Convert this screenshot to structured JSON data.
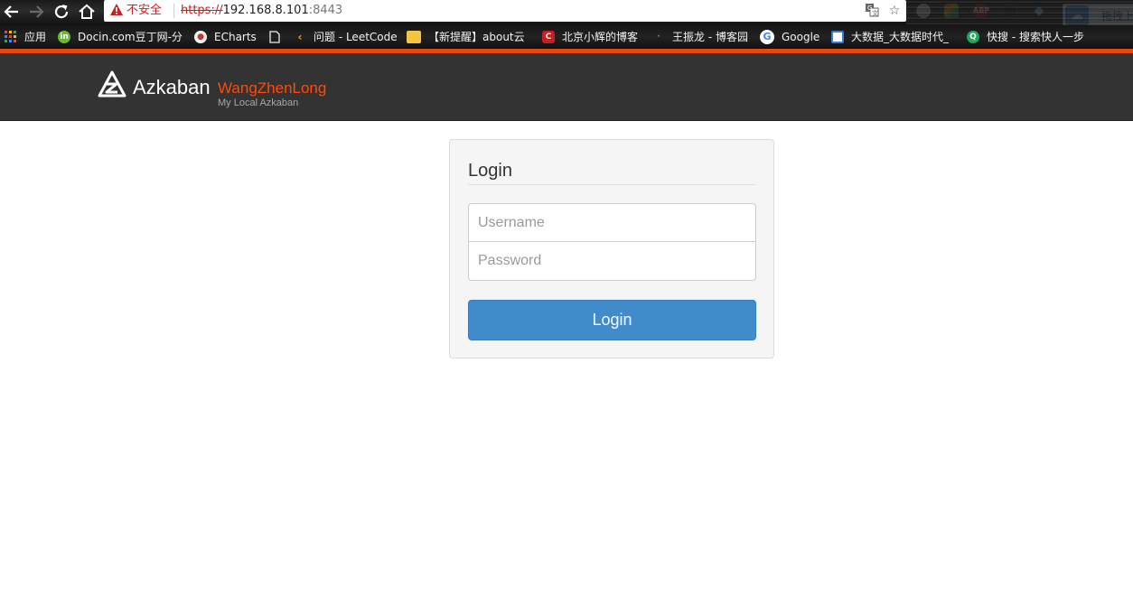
{
  "browser": {
    "back_icon": "arrow-left-icon",
    "forward_icon": "arrow-right-icon",
    "reload_icon": "reload-icon",
    "home_icon": "home-icon",
    "security_label": "不安全",
    "url_scheme": "https://",
    "url_host": "192.168.8.101",
    "url_port": ":8443",
    "baidu_button_label": "拖拽上",
    "extensions": [
      "ABP"
    ]
  },
  "bookmarks": [
    {
      "label": "应用",
      "icon": "apps-grid-icon",
      "color": "#e8a33d"
    },
    {
      "label": "Docin.com豆丁网-分",
      "icon": "docin-icon",
      "color": "#6ab82f"
    },
    {
      "label": "ECharts",
      "icon": "echarts-icon",
      "color": "#c23531"
    },
    {
      "label": "",
      "icon": "page-icon",
      "color": "#dddddd"
    },
    {
      "label": "问题 - LeetCode",
      "icon": "leetcode-icon",
      "color": "#f89f1b"
    },
    {
      "label": "【新提醒】about云",
      "icon": "aboutyun-icon",
      "color": "#f5c542"
    },
    {
      "label": "北京小辉的博客",
      "icon": "csdn-icon",
      "color": "#c71d23"
    },
    {
      "label": "王振龙 - 博客园",
      "icon": "cnblogs-icon",
      "color": "#555555"
    },
    {
      "label": "Google",
      "icon": "google-icon",
      "color": "#4285f4"
    },
    {
      "label": "大数据_大数据时代_",
      "icon": "bigdata-icon",
      "color": "#3a7bd5"
    },
    {
      "label": "快搜 - 搜索快人一步",
      "icon": "kuaisou-icon",
      "color": "#21a558"
    }
  ],
  "app": {
    "title": "Azkaban",
    "name": "WangZhenLong",
    "subtitle": "My Local Azkaban",
    "accent_color": "#ff4a0a",
    "header_color": "#333333"
  },
  "login": {
    "heading": "Login",
    "username_placeholder": "Username",
    "password_placeholder": "Password",
    "username_value": "",
    "password_value": "",
    "button_label": "Login",
    "button_color": "#428bca"
  }
}
